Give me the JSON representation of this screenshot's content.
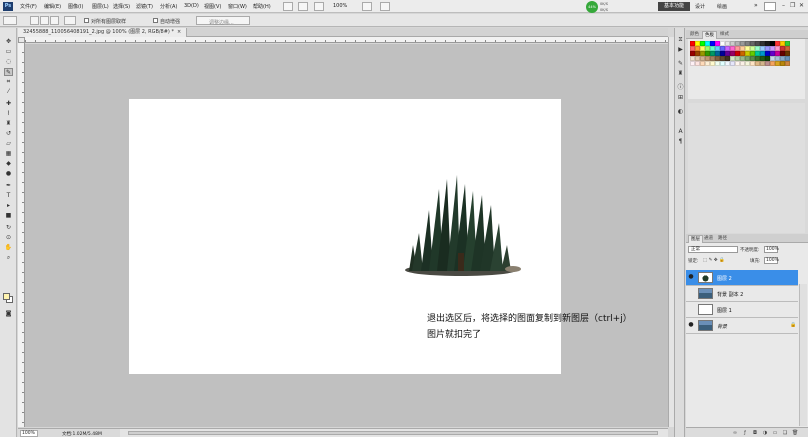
{
  "menubar": {
    "logo": "Ps",
    "items": [
      "文件(F)",
      "编辑(E)",
      "图像(I)",
      "图层(L)",
      "选择(S)",
      "滤镜(T)",
      "分析(A)",
      "3D(D)",
      "视图(V)",
      "窗口(W)",
      "帮助(H)"
    ],
    "zoom": "100%",
    "mini_bridge": {
      "percent": "44%",
      "stat_up": "0K/S",
      "stat_down": "0K/S"
    },
    "workspace": "基本功能",
    "workspace_links": [
      "设计",
      "绘画"
    ],
    "more": "»"
  },
  "options_bar": {
    "sample_all_layers": "对所有图层取样",
    "auto_enhance": "自动增强",
    "refine_edge": "调整边缘..."
  },
  "document": {
    "tab_title": "32455888_110056408191_2.jpg @ 100% (图层 2, RGB/8#) *",
    "tab_close": "×"
  },
  "canvas": {
    "caption_line1": "退出选区后，将选择的图面复制到新图层（ctrl+j）",
    "caption_line2": "图片就扣完了"
  },
  "status": {
    "zoom": "100%",
    "doc_info": "文档:1.02M/5.48M"
  },
  "panels": {
    "color_tabs": [
      "颜色",
      "色板",
      "样式"
    ],
    "layers_tabs": [
      "图层",
      "通道",
      "路径"
    ],
    "blend_mode": "正常",
    "opacity_label": "不透明度:",
    "opacity": "100%",
    "lock_label": "锁定:",
    "fill_label": "填充:",
    "fill": "100%",
    "layers": [
      {
        "name": "图层 2",
        "selected": true,
        "thumb": "tree",
        "visible": true
      },
      {
        "name": "背景 副本 2",
        "selected": false,
        "thumb": "scene",
        "visible": false
      },
      {
        "name": "图层 1",
        "selected": false,
        "thumb": "white",
        "visible": false
      },
      {
        "name": "背景",
        "selected": false,
        "thumb": "scene",
        "visible": true,
        "locked": true
      }
    ]
  },
  "swatch_colors": [
    "#ff0000",
    "#ffff00",
    "#00ff00",
    "#00ffff",
    "#0000ff",
    "#ff00ff",
    "#ffffff",
    "#e6e6e6",
    "#cccccc",
    "#b3b3b3",
    "#999999",
    "#808080",
    "#666666",
    "#4d4d4d",
    "#333333",
    "#1a1a1a",
    "#000000",
    "#ff3333",
    "#ffcc00",
    "#33cc33",
    "#ff6666",
    "#ff9933",
    "#ffff66",
    "#99ff66",
    "#66ffcc",
    "#66ccff",
    "#6666ff",
    "#cc66ff",
    "#ff66cc",
    "#ff9999",
    "#ffcc99",
    "#ffff99",
    "#ccff99",
    "#99ffcc",
    "#99ccff",
    "#9999ff",
    "#cc99ff",
    "#ff99cc",
    "#cc3333",
    "#cc6633",
    "#990000",
    "#994400",
    "#999900",
    "#339900",
    "#009966",
    "#006699",
    "#000099",
    "#660099",
    "#990066",
    "#cc0000",
    "#cc6600",
    "#cccc00",
    "#66cc00",
    "#00cc99",
    "#0099cc",
    "#0000cc",
    "#6600cc",
    "#cc0099",
    "#660000",
    "#663300",
    "#f0e0d0",
    "#e0c8b0",
    "#d0b090",
    "#c09870",
    "#a08060",
    "#806040",
    "#604830",
    "#403020",
    "#d8e8c8",
    "#b8d0a8",
    "#98b888",
    "#78a068",
    "#588848",
    "#387028",
    "#205818",
    "#104008",
    "#c8d8e8",
    "#a8c0d8",
    "#88a8c8",
    "#6890b8",
    "#fff0f5",
    "#ffe4e1",
    "#ffdab9",
    "#ffefd5",
    "#fffacd",
    "#f0fff0",
    "#e0ffff",
    "#f0f8ff",
    "#e6e6fa",
    "#fff5ee",
    "#faf0e6",
    "#f5f5dc",
    "#ffe4c4",
    "#deb887",
    "#d2b48c",
    "#bc8f8f",
    "#f4a460",
    "#daa520",
    "#b8860b",
    "#cd853f"
  ]
}
